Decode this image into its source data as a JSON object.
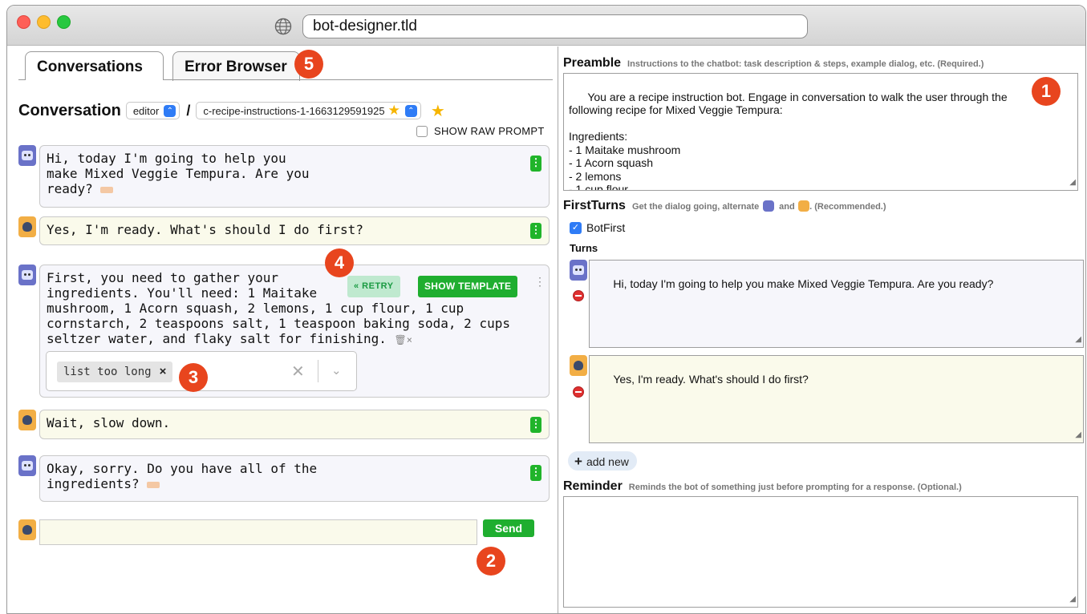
{
  "browser": {
    "url": "bot-designer.tld",
    "globe_icon": "globe-icon"
  },
  "tabs": [
    {
      "label": "Conversations",
      "active": true
    },
    {
      "label": "Error Browser",
      "active": false
    }
  ],
  "badges": {
    "b1": "1",
    "b2": "2",
    "b3": "3",
    "b4": "4",
    "b5": "5"
  },
  "conversation": {
    "title": "Conversation",
    "editor_select": "editor",
    "slash": "/",
    "conv_select": "c-recipe-instructions-1-1663129591925",
    "star": "★",
    "show_raw_prompt": "SHOW RAW PROMPT",
    "messages": [
      {
        "role": "bot",
        "text": "Hi, today I'm going to help you\nmake Mixed Veggie Tempura. Are you\nready?"
      },
      {
        "role": "user",
        "text": "Yes, I'm ready. What's should I do first?"
      },
      {
        "role": "bot",
        "text": "First, you need to gather your\ningredients. You'll need: 1 Maitake\nmushroom, 1 Acorn squash, 2 lemons, 1 cup flour, 1 cup\ncornstarch, 2 teaspoons salt, 1 teaspoon baking soda, 2 cups\nseltzer water, and flaky salt for finishing."
      },
      {
        "role": "user",
        "text": "Wait, slow down."
      },
      {
        "role": "bot",
        "text": "Okay, sorry. Do you have all of the\ningredients?"
      }
    ],
    "retry_label": "« RETRY",
    "template_label": "SHOW TEMPLATE",
    "error_chip": "list too long",
    "chip_remove": "×",
    "clear": "✕",
    "dropdown": "⌄",
    "trash_suffix": "×",
    "send_label": "Send"
  },
  "right": {
    "preamble": {
      "title": "Preamble",
      "subtitle": "Instructions to the chatbot: task description & steps, example dialog, etc. (Required.)",
      "text": "You are a recipe instruction bot. Engage in conversation to walk the user through the\nfollowing recipe for Mixed Veggie Tempura:\n\nIngredients:\n- 1 Maitake mushroom\n- 1 Acorn squash\n- 2 lemons\n- 1 cup flour"
    },
    "firstturns": {
      "title": "FirstTurns",
      "subtitle_a": "Get the dialog going, alternate",
      "subtitle_b": "and",
      "subtitle_c": ". (Recommended.)",
      "botfirst": "BotFirst",
      "turns_label": "Turns",
      "turns": [
        {
          "role": "bot",
          "text": "Hi, today I'm going to help you make Mixed Veggie Tempura. Are you ready?"
        },
        {
          "role": "user",
          "text": "Yes, I'm ready. What's should I do first?"
        }
      ],
      "add_new": "add new",
      "add_plus": "+"
    },
    "reminder": {
      "title": "Reminder",
      "subtitle": "Reminds the bot of something just before prompting for a response. (Optional.)"
    }
  },
  "colors": {
    "accent_green": "#1fae2f",
    "badge_red": "#e8451e",
    "bot_purple": "#6a72c8",
    "user_orange": "#f2ae45"
  }
}
